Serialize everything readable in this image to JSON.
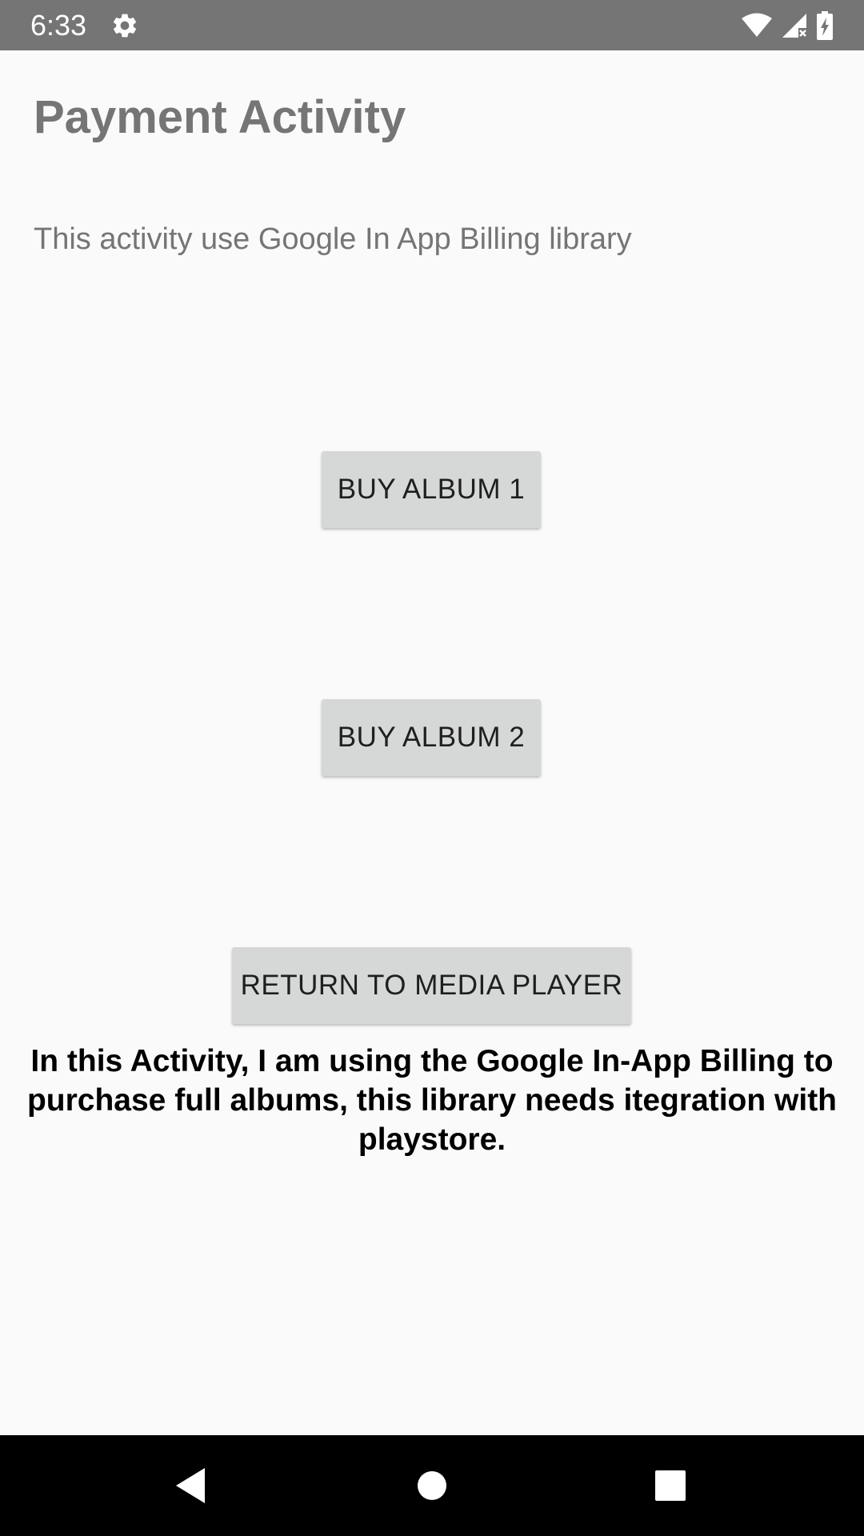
{
  "status_bar": {
    "time": "6:33",
    "icons": [
      "gear-icon",
      "wifi-icon",
      "signal-icon",
      "battery-icon"
    ],
    "background_color": "#757575"
  },
  "page": {
    "title": "Payment Activity",
    "subtitle": "This activity use Google In App Billing library",
    "buttons": {
      "buy_album_1": "BUY ALBUM 1",
      "buy_album_2": "BUY ALBUM 2",
      "return": "RETURN TO MEDIA PLAYER"
    },
    "info_text": "In this Activity, I am using the Google In-App Billing to purchase full albums, this library needs itegration with playstore."
  },
  "nav_bar": {
    "icons": [
      "back-icon",
      "home-icon",
      "recents-icon"
    ]
  },
  "colors": {
    "background": "#fafafa",
    "button": "#d6d7d7",
    "title_text": "#757575"
  }
}
